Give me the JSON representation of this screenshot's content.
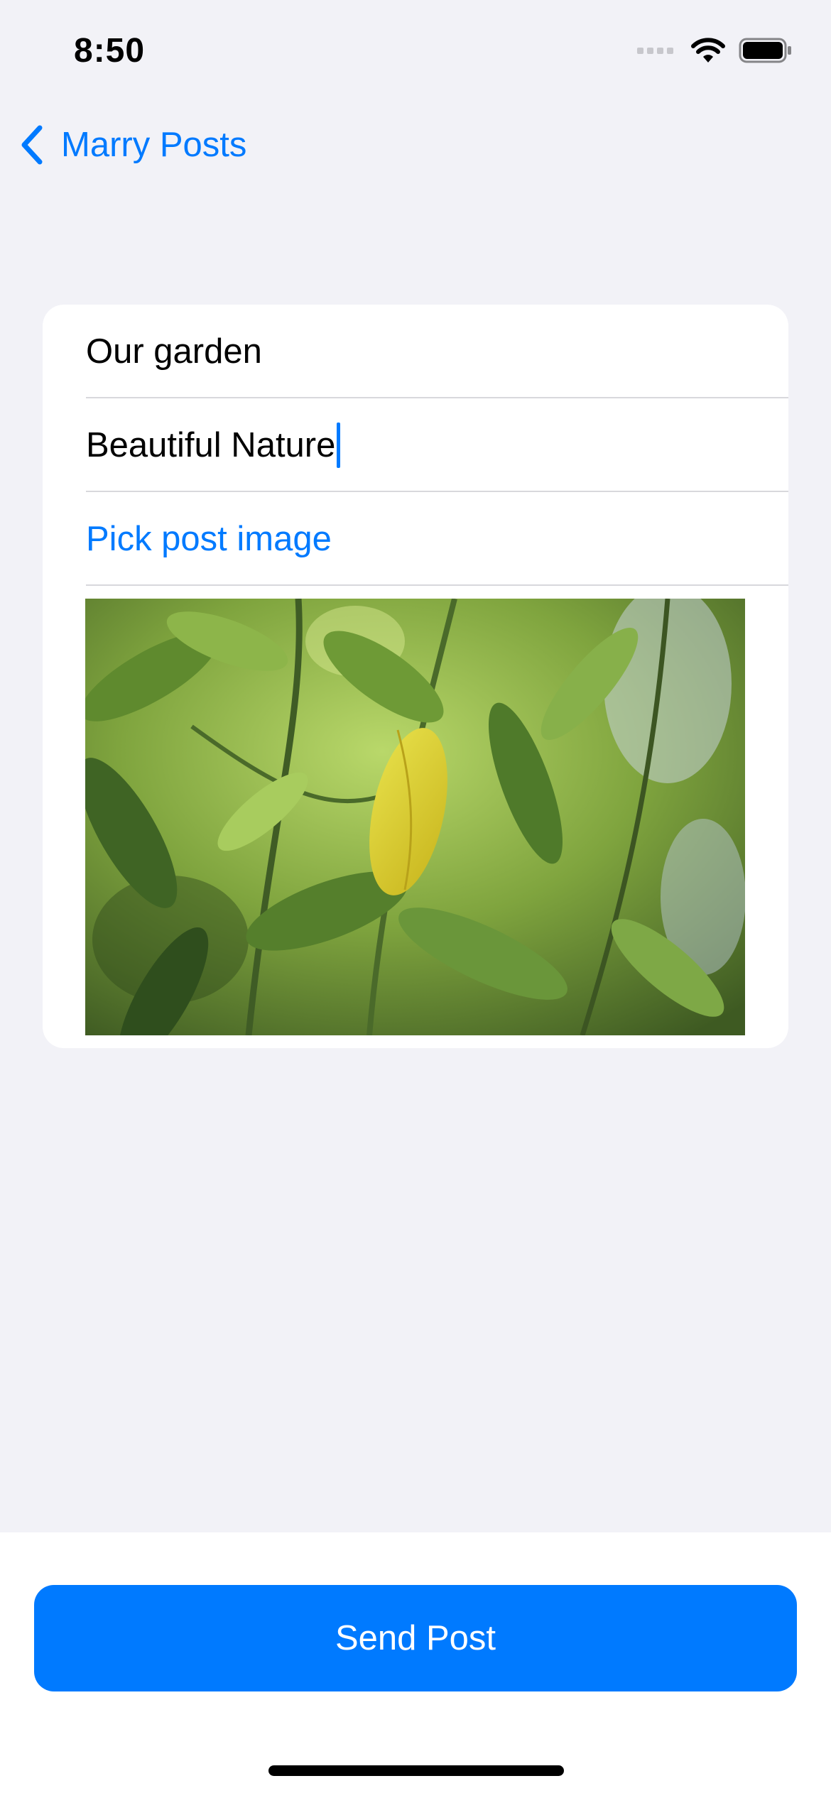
{
  "status_bar": {
    "time": "8:50",
    "icons": [
      "cellular-signal-icon",
      "wifi-icon",
      "battery-icon"
    ]
  },
  "nav": {
    "back_label": "Marry Posts",
    "back_icon": "chevron-left-icon"
  },
  "form": {
    "title_value": "Our garden",
    "description_value": "Beautiful Nature",
    "pick_image_label": "Pick post image",
    "image_alt": "green leaves photo"
  },
  "actions": {
    "send_label": "Send Post"
  },
  "colors": {
    "accent": "#007AFF",
    "background": "#F2F2F7",
    "card": "#FFFFFF"
  }
}
